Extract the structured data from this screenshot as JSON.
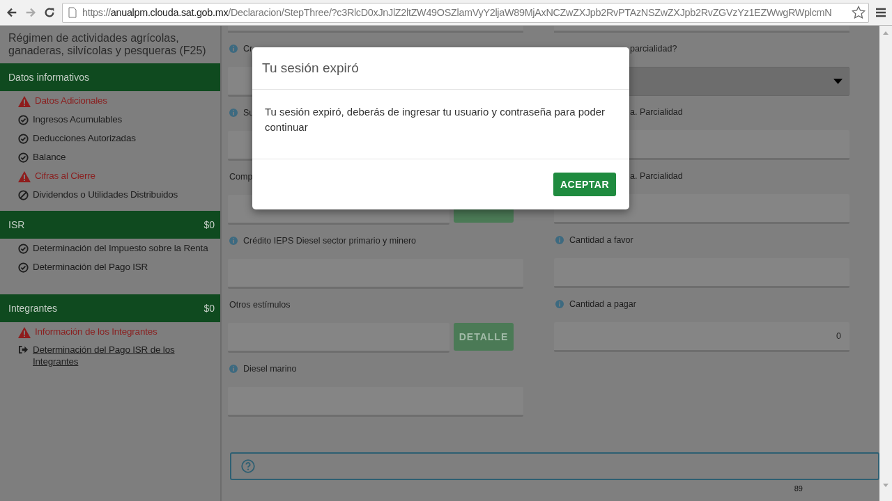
{
  "browser": {
    "url": {
      "scheme": "https://",
      "host": "anualpm.clouda.sat.gob.mx",
      "path": "/Declaracion/StepThree/?c3RlcD0xJnJlZ2ltZW49OSZlamVyY2ljaW89MjAxNCZwZXJpb2RvPTAzNSZwZXJpb2RvZGVzYz1EZWwgRWplcmN"
    }
  },
  "sidebar": {
    "title": "Régimen de actividades agrícolas, ganaderas, silvícolas y pesqueras (F25)",
    "sections": [
      {
        "title": "Datos informativos",
        "items": [
          {
            "label": "Datos Adicionales",
            "kind": "warning"
          },
          {
            "label": "Ingresos Acumulables",
            "kind": "done"
          },
          {
            "label": "Deducciones Autorizadas",
            "kind": "done"
          },
          {
            "label": "Balance",
            "kind": "done"
          },
          {
            "label": "Cifras al Cierre",
            "kind": "warning"
          },
          {
            "label": "Dividendos o Utilidades Distribuidos",
            "kind": "blocked"
          }
        ]
      },
      {
        "title": "ISR",
        "amount": "$0",
        "items": [
          {
            "label": "Determinación del Impuesto sobre la Renta",
            "kind": "done"
          },
          {
            "label": "Determinación del Pago ISR",
            "kind": "done"
          }
        ]
      },
      {
        "title": "Integrantes",
        "amount": "$0",
        "items": [
          {
            "label": "Información de los Integrantes",
            "kind": "warning"
          },
          {
            "label": "Determinación del Pago ISR de los Integrantes",
            "kind": "link"
          }
        ]
      }
    ]
  },
  "form": {
    "left": [
      {
        "label": "Cr",
        "info": true,
        "kind": "input"
      },
      {
        "label": "Su",
        "info": true,
        "kind": "input"
      },
      {
        "label": "Comp",
        "info": false,
        "kind": "input_detail"
      },
      {
        "label": "Crédito IEPS Diesel sector primario y minero",
        "info": true,
        "kind": "input"
      },
      {
        "label": "Otros estímulos",
        "info": false,
        "kind": "input_detail",
        "button": "DETALLE"
      },
      {
        "label": "Diesel marino",
        "info": true,
        "kind": "input"
      }
    ],
    "right": [
      {
        "label": "parcialidad?",
        "info": false,
        "covered": true,
        "kind": "select"
      },
      {
        "label": "a. Parcialidad",
        "info": false,
        "covered": true,
        "kind": "input"
      },
      {
        "label": "a. Parcialidad",
        "info": false,
        "covered": true,
        "kind": "input"
      },
      {
        "label": "Cantidad a favor",
        "info": true,
        "kind": "input"
      },
      {
        "label": "Cantidad a pagar",
        "info": true,
        "kind": "input",
        "value": "0"
      }
    ]
  },
  "page_number": "89",
  "dialog": {
    "title": "Tu sesión expiró",
    "message": "Tu sesión expiró, deberás de ingresar tu usuario y contraseña para poder continuar",
    "button": "ACEPTAR"
  }
}
